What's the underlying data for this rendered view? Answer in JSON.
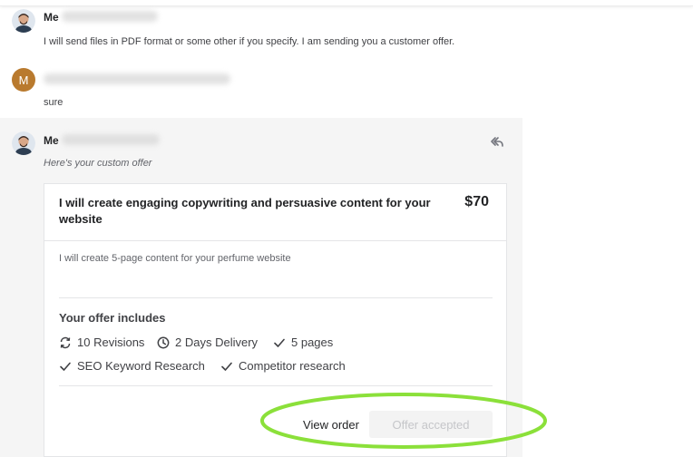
{
  "messages": [
    {
      "sender": "Me",
      "avatar": "user-photo-avatar",
      "text": "I will send files in PDF format or some other if you specify. I am sending you a customer offer."
    },
    {
      "sender": "",
      "avatar_letter": "M",
      "text": "sure"
    }
  ],
  "offer_message": {
    "sender": "Me",
    "intro": "Here's your custom offer",
    "reply_icon": "reply-arrow-icon",
    "card": {
      "title": "I will create engaging copywriting and persuasive content for your website",
      "price": "$70",
      "description": "I will create 5-page content for your perfume website",
      "includes_title": "Your offer includes",
      "features": [
        {
          "icon": "refresh-icon",
          "label": "10 Revisions"
        },
        {
          "icon": "clock-icon",
          "label": "2 Days Delivery"
        },
        {
          "icon": "check-icon",
          "label": "5 pages"
        },
        {
          "icon": "check-icon",
          "label": "SEO Keyword Research"
        },
        {
          "icon": "check-icon",
          "label": "Competitor research"
        }
      ],
      "view_order_label": "View order",
      "status_button_label": "Offer accepted"
    }
  },
  "colors": {
    "highlight": "#8be03a",
    "offer_background": "#f5f5f5",
    "border": "#e4e5e7",
    "avatar_letter_bg": "#b97a2e"
  }
}
